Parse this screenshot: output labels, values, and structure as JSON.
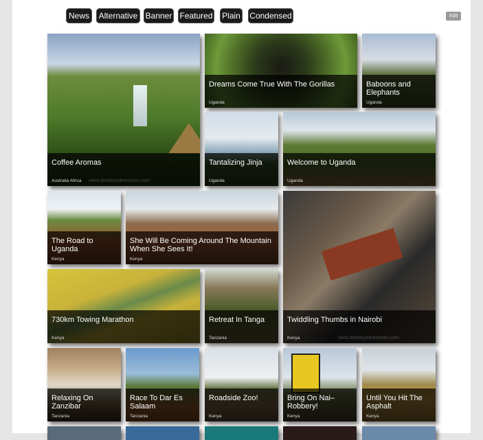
{
  "tabs": [
    "News",
    "Alternative",
    "Banner",
    "Featured",
    "Plain",
    "Condensed"
  ],
  "edit_label": "Edit",
  "tiles": [
    {
      "title": "Coffee Aromas",
      "sub": "Australia Africa"
    },
    {
      "title": "Dreams Come True With The Gorillas",
      "sub": "Uganda"
    },
    {
      "title": "Baboons and Elephants",
      "sub": "Uganda"
    },
    {
      "title": "Tantalizing Jinja",
      "sub": "Uganda"
    },
    {
      "title": "Welcome to Uganda",
      "sub": "Uganda"
    },
    {
      "title": "The Road to Uganda",
      "sub": "Kenya"
    },
    {
      "title": "She Will Be Coming Around The Mountain When She Sees It!",
      "sub": "Kenya"
    },
    {
      "title": "Twiddling Thumbs in Nairobi",
      "sub": "Kenya"
    },
    {
      "title": "730km Towing Marathon",
      "sub": "Kenya"
    },
    {
      "title": "Retreat In Tanga",
      "sub": "Tanzania"
    },
    {
      "title": "Relaxing On Zanzibar",
      "sub": "Tanzania"
    },
    {
      "title": "Race To Dar Es Salaam",
      "sub": "Tanzania"
    },
    {
      "title": "Roadside Zoo!",
      "sub": "Kenya"
    },
    {
      "title": "Bring On Nai– Robbery!",
      "sub": "Kenya"
    },
    {
      "title": "Until You Hit The Asphalt",
      "sub": "Kenya"
    }
  ],
  "watermark": "www.donkeyadventures.com",
  "colors": {
    "tab_bg": "#1a1a1a",
    "page_bg": "#ffffff",
    "outer_bg": "#e6e6e6",
    "caption_bg": "rgba(0,0,0,0.72)"
  }
}
